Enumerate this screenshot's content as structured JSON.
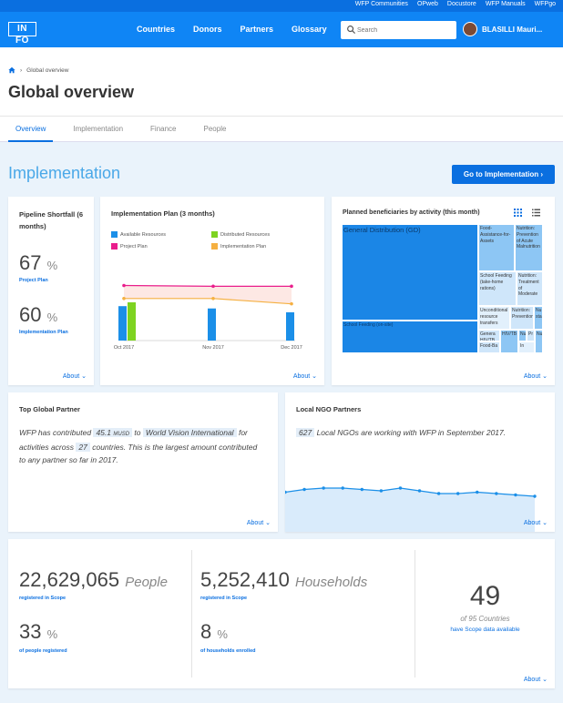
{
  "topbar": {
    "links": [
      "WFP Communities",
      "OPweb",
      "Docustore",
      "WFP Manuals",
      "WFPgo"
    ]
  },
  "nav": {
    "logo": "IN FO",
    "links": [
      "Countries",
      "Donors",
      "Partners",
      "Glossary"
    ],
    "search_placeholder": "Search",
    "user": "BLASILLI Mauri..."
  },
  "breadcrumb": "Global overview",
  "page_title": "Global overview",
  "tabs": [
    "Overview",
    "Implementation",
    "Finance",
    "People"
  ],
  "section": {
    "title": "Implementation",
    "button": "Go to Implementation"
  },
  "pipeline": {
    "title": "Pipeline Shortfall (6 months)",
    "v1": "67",
    "v1_label": "Project Plan",
    "v2": "60",
    "v2_label": "Implementation Plan",
    "unit": "%",
    "about": "About"
  },
  "impl_plan": {
    "title": "Implementation Plan (3 months)",
    "legend": [
      "Available Resources",
      "Distributed Resources",
      "Project Plan",
      "Implementation Plan"
    ],
    "colors": {
      "available": "#1b8fe8",
      "distributed": "#7ed321",
      "project": "#e91e8c",
      "implementation": "#f5b041"
    },
    "about": "About"
  },
  "chart_data": {
    "type": "bar",
    "categories": [
      "Oct 2017",
      "Nov 2017",
      "Dec 2017"
    ],
    "series": [
      {
        "name": "Available Resources",
        "values": [
          45,
          42,
          37
        ]
      },
      {
        "name": "Distributed Resources",
        "values": [
          50,
          0,
          0
        ]
      },
      {
        "name": "Project Plan",
        "values": [
          72,
          71,
          71
        ]
      },
      {
        "name": "Implementation Plan",
        "values": [
          55,
          55,
          48
        ]
      }
    ],
    "ylim": [
      0,
      100
    ]
  },
  "beneficiaries": {
    "title": "Planned beneficiaries by activity (this month)",
    "cells": [
      "General Distribution (GD)",
      "School Feeding (on-site)",
      "Food-Assistance-for-Assets",
      "Nutrition: Prevention of Acute Malnutrition",
      "School Feeding (take-home rations)",
      "Nutrition: Treatment of Moderate",
      "Unconditional resource transfers",
      "Nutrition: Prevention",
      "Nu sta",
      "Genera HIV/TB",
      "Food-Ba",
      "HIV/TB",
      "Nu",
      "Pr",
      "In",
      "Nu"
    ],
    "about": "About"
  },
  "top_partner": {
    "title": "Top Global Partner",
    "t1": "WFP has contributed",
    "amount": "45.1",
    "amount_unit": "MUSD",
    "t2": "to",
    "partner": "World Vision International",
    "t3": "for activities across",
    "countries": "27",
    "t4": "countries. This is the largest amount contributed to any partner so far in 2017.",
    "about": "About"
  },
  "ngo": {
    "title": "Local NGO Partners",
    "count": "627",
    "text": "Local NGOs are working with WFP in September 2017.",
    "about": "About",
    "trend": [
      41,
      43,
      44,
      44,
      43,
      42,
      44,
      42,
      40,
      40,
      41,
      40,
      39,
      38
    ]
  },
  "scope": {
    "people": "22,629,065",
    "people_unit": "People",
    "people_label": "registered in Scope",
    "people_pct": "33",
    "people_pct_label": "of people registered",
    "households": "5,252,410",
    "households_unit": "Households",
    "households_label": "registered in Scope",
    "households_pct": "8",
    "households_pct_label": "of households enrolled",
    "pct_unit": "%",
    "countries": "49",
    "countries_of": "of 95 Countries",
    "countries_label": "have Scope data available",
    "about": "About"
  }
}
